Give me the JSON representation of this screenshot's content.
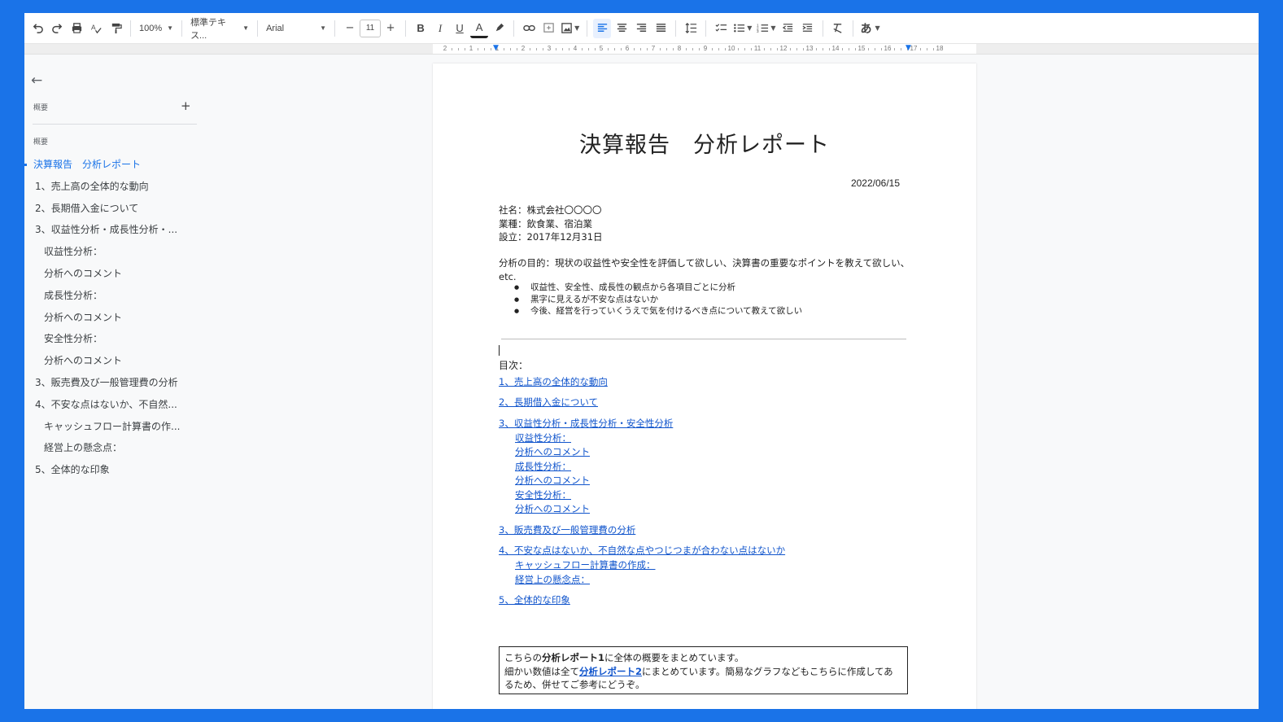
{
  "toolbar": {
    "zoom": "100%",
    "style": "標準テキス...",
    "font": "Arial",
    "font_size": "11",
    "bold": "B",
    "italic": "I",
    "underline": "U",
    "text_color": "A",
    "input_tool": "あ"
  },
  "ruler": {
    "labels": [
      "2",
      "1",
      "1",
      "2",
      "3",
      "4",
      "5",
      "6",
      "7",
      "8",
      "9",
      "10",
      "11",
      "12",
      "13",
      "14",
      "15",
      "16",
      "17",
      "18"
    ]
  },
  "outline": {
    "header": "概要",
    "summary_header": "概要",
    "items": [
      {
        "label": "決算報告　分析レポート",
        "level": "current"
      },
      {
        "label": "1、売上高の全体的な動向",
        "level": "l1"
      },
      {
        "label": "2、長期借入金について",
        "level": "l1"
      },
      {
        "label": "3、収益性分析・成長性分析・...",
        "level": "l1"
      },
      {
        "label": "収益性分析：",
        "level": "l2"
      },
      {
        "label": "分析へのコメント",
        "level": "l2"
      },
      {
        "label": "成長性分析：",
        "level": "l2"
      },
      {
        "label": "分析へのコメント",
        "level": "l2"
      },
      {
        "label": "安全性分析：",
        "level": "l2"
      },
      {
        "label": "分析へのコメント",
        "level": "l2"
      },
      {
        "label": "3、販売費及び一般管理費の分析",
        "level": "l1"
      },
      {
        "label": "4、不安な点はないか、不自然...",
        "level": "l1"
      },
      {
        "label": "キャッシュフロー計算書の作...",
        "level": "l2"
      },
      {
        "label": "経営上の懸念点：",
        "level": "l2"
      },
      {
        "label": "5、全体的な印象",
        "level": "l1"
      }
    ]
  },
  "document": {
    "title": "決算報告　分析レポート",
    "date": "2022/06/15",
    "company": "社名：株式会社〇〇〇〇",
    "industry": "業種：飲食業、宿泊業",
    "founded": "設立：2017年12月31日",
    "purpose": "分析の目的：現状の収益性や安全性を評価して欲しい、決算書の重要なポイントを教えて欲しい、etc.",
    "bullets": [
      "収益性、安全性、成長性の観点から各項目ごとに分析",
      "黒字に見えるが不安な点はないか",
      "今後、経営を行っていくうえで気を付けるべき点について教えて欲しい"
    ],
    "toc_label": "目次：",
    "toc": [
      "1、売上高の全体的な動向",
      "2、長期借入金について",
      "3、収益性分析・成長性分析・安全性分析",
      "収益性分析：",
      "分析へのコメント",
      "成長性分析：",
      "分析へのコメント",
      "安全性分析：",
      "分析へのコメント",
      "3、販売費及び一般管理費の分析",
      "4、不安な点はないか、不自然な点やつじつまが合わない点はないか",
      "キャッシュフロー計算書の作成：",
      "経営上の懸念点：",
      "5、全体的な印象"
    ],
    "note": {
      "line1_pre": "こちらの",
      "line1_bold": "分析レポート1",
      "line1_post": "に全体の概要をまとめています。",
      "line2_pre": "細かい数値は全て",
      "line2_link": "分析レポート2",
      "line2_post": "にまとめています。簡易なグラフなどもこちらに作成してあるため、併せてご参考にどうぞ。"
    }
  }
}
